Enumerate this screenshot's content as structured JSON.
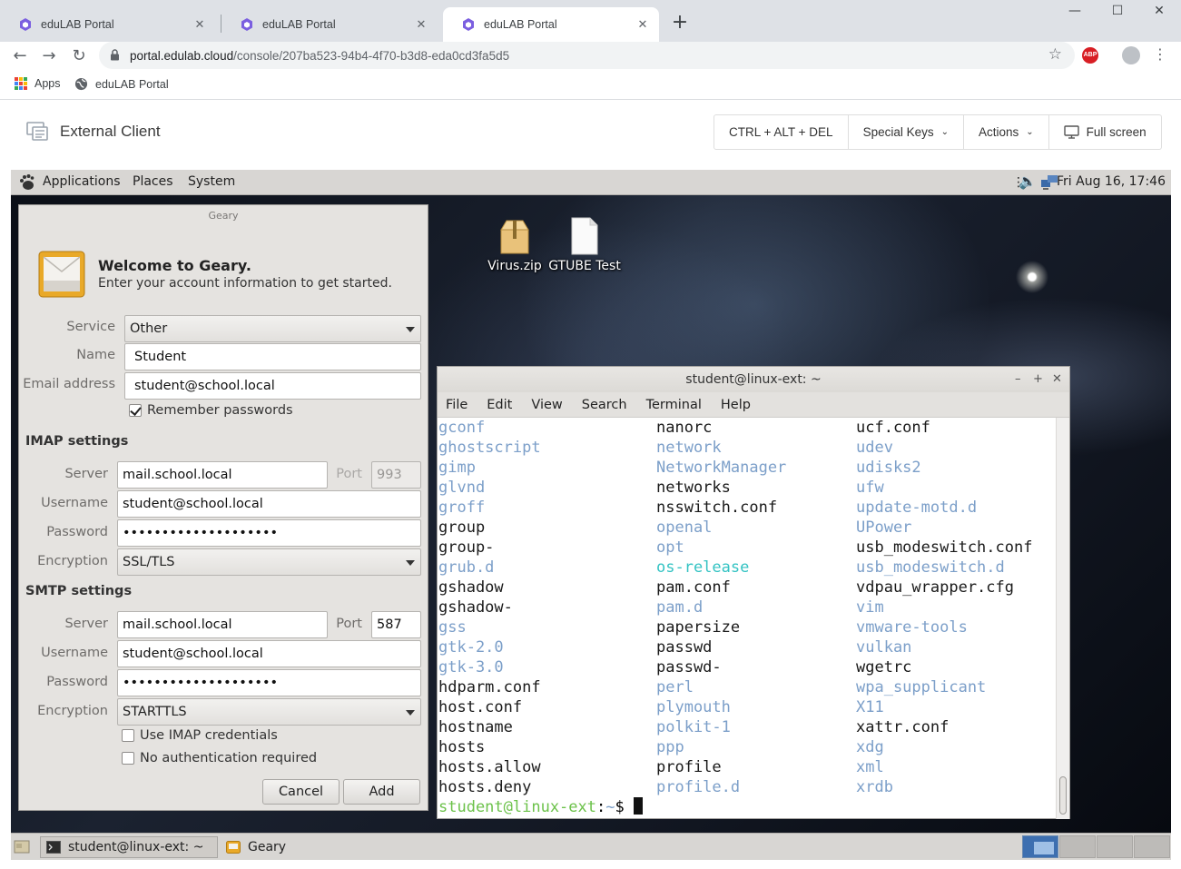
{
  "browser": {
    "tabs": [
      {
        "title": "eduLAB Portal",
        "active": false
      },
      {
        "title": "eduLAB Portal",
        "active": false
      },
      {
        "title": "eduLAB Portal",
        "active": true
      }
    ],
    "url_host": "portal.edulab.cloud",
    "url_path": "/console/207ba523-94b4-4f70-b3d8-eda0cd3fa5d5",
    "bookmarks": [
      {
        "label": "Apps",
        "icon": "apps-grid-icon"
      },
      {
        "label": "eduLAB Portal",
        "icon": "globe-icon"
      }
    ],
    "extension_badge": "ABP",
    "accent": "#7b5fe0"
  },
  "portal": {
    "title": "External Client",
    "buttons": {
      "ctrl_alt_del": "CTRL + ALT + DEL",
      "special_keys": "Special Keys",
      "actions": "Actions",
      "fullscreen": "Full screen"
    }
  },
  "remote": {
    "topbar": {
      "menus": [
        "Applications",
        "Places",
        "System"
      ],
      "clock": "Fri Aug 16, 17:46"
    },
    "desktop_icons": [
      {
        "label": "Virus.zip",
        "icon": "zip-archive-icon"
      },
      {
        "label": "GTUBE Test",
        "icon": "text-file-icon"
      }
    ],
    "taskbar": {
      "items": [
        {
          "label": "student@linux-ext: ~",
          "icon": "terminal-icon"
        },
        {
          "label": "Geary",
          "icon": "geary-mail-icon"
        }
      ]
    }
  },
  "geary": {
    "window_title": "Geary",
    "welcome": "Welcome to Geary.",
    "subtitle": "Enter your account information to get started.",
    "service_label": "Service",
    "service_value": "Other",
    "name_label": "Name",
    "name_value": "Student",
    "email_label": "Email address",
    "email_value": "student@school.local",
    "remember_label": "Remember passwords",
    "remember_checked": true,
    "imap": {
      "heading": "IMAP settings",
      "server_label": "Server",
      "server_value": "mail.school.local",
      "port_label": "Port",
      "port_value": "993",
      "username_label": "Username",
      "username_value": "student@school.local",
      "password_label": "Password",
      "password_value": "••••••••••••••••••••",
      "encryption_label": "Encryption",
      "encryption_value": "SSL/TLS"
    },
    "smtp": {
      "heading": "SMTP settings",
      "server_label": "Server",
      "server_value": "mail.school.local",
      "port_label": "Port",
      "port_value": "587",
      "username_label": "Username",
      "username_value": "student@school.local",
      "password_label": "Password",
      "password_value": "••••••••••••••••••••",
      "encryption_label": "Encryption",
      "encryption_value": "STARTTLS"
    },
    "use_imap_label": "Use IMAP credentials",
    "use_imap_checked": false,
    "no_auth_label": "No authentication required",
    "no_auth_checked": false,
    "cancel_label": "Cancel",
    "add_label": "Add"
  },
  "terminal": {
    "title": "student@linux-ext: ~",
    "menu": [
      "File",
      "Edit",
      "View",
      "Search",
      "Terminal",
      "Help"
    ],
    "columns": [
      [
        {
          "name": "gconf",
          "kind": "dir"
        },
        {
          "name": "ghostscript",
          "kind": "dir"
        },
        {
          "name": "gimp",
          "kind": "dir"
        },
        {
          "name": "glvnd",
          "kind": "dir"
        },
        {
          "name": "groff",
          "kind": "dir"
        },
        {
          "name": "group",
          "kind": "file"
        },
        {
          "name": "group-",
          "kind": "file"
        },
        {
          "name": "grub.d",
          "kind": "dir"
        },
        {
          "name": "gshadow",
          "kind": "file"
        },
        {
          "name": "gshadow-",
          "kind": "file"
        },
        {
          "name": "gss",
          "kind": "dir"
        },
        {
          "name": "gtk-2.0",
          "kind": "dir"
        },
        {
          "name": "gtk-3.0",
          "kind": "dir"
        },
        {
          "name": "hdparm.conf",
          "kind": "file"
        },
        {
          "name": "host.conf",
          "kind": "file"
        },
        {
          "name": "hostname",
          "kind": "file"
        },
        {
          "name": "hosts",
          "kind": "file"
        },
        {
          "name": "hosts.allow",
          "kind": "file"
        },
        {
          "name": "hosts.deny",
          "kind": "file"
        }
      ],
      [
        {
          "name": "nanorc",
          "kind": "file"
        },
        {
          "name": "network",
          "kind": "dir"
        },
        {
          "name": "NetworkManager",
          "kind": "dir"
        },
        {
          "name": "networks",
          "kind": "file"
        },
        {
          "name": "nsswitch.conf",
          "kind": "file"
        },
        {
          "name": "openal",
          "kind": "dir"
        },
        {
          "name": "opt",
          "kind": "dir"
        },
        {
          "name": "os-release",
          "kind": "link"
        },
        {
          "name": "pam.conf",
          "kind": "file"
        },
        {
          "name": "pam.d",
          "kind": "dir"
        },
        {
          "name": "papersize",
          "kind": "file"
        },
        {
          "name": "passwd",
          "kind": "file"
        },
        {
          "name": "passwd-",
          "kind": "file"
        },
        {
          "name": "perl",
          "kind": "dir"
        },
        {
          "name": "plymouth",
          "kind": "dir"
        },
        {
          "name": "polkit-1",
          "kind": "dir"
        },
        {
          "name": "ppp",
          "kind": "dir"
        },
        {
          "name": "profile",
          "kind": "file"
        },
        {
          "name": "profile.d",
          "kind": "dir"
        }
      ],
      [
        {
          "name": "ucf.conf",
          "kind": "file"
        },
        {
          "name": "udev",
          "kind": "dir"
        },
        {
          "name": "udisks2",
          "kind": "dir"
        },
        {
          "name": "ufw",
          "kind": "dir"
        },
        {
          "name": "update-motd.d",
          "kind": "dir"
        },
        {
          "name": "UPower",
          "kind": "dir"
        },
        {
          "name": "usb_modeswitch.conf",
          "kind": "file"
        },
        {
          "name": "usb_modeswitch.d",
          "kind": "dir"
        },
        {
          "name": "vdpau_wrapper.cfg",
          "kind": "file"
        },
        {
          "name": "vim",
          "kind": "dir"
        },
        {
          "name": "vmware-tools",
          "kind": "dir"
        },
        {
          "name": "vulkan",
          "kind": "dir"
        },
        {
          "name": "wgetrc",
          "kind": "file"
        },
        {
          "name": "wpa_supplicant",
          "kind": "dir"
        },
        {
          "name": "X11",
          "kind": "dir"
        },
        {
          "name": "xattr.conf",
          "kind": "file"
        },
        {
          "name": "xdg",
          "kind": "dir"
        },
        {
          "name": "xml",
          "kind": "dir"
        },
        {
          "name": "xrdb",
          "kind": "dir"
        }
      ]
    ],
    "prompt_user": "student@linux-ext",
    "prompt_sep": ":",
    "prompt_path": "~",
    "prompt_symbol": "$ ",
    "colors": {
      "dir": "#7c9fc9",
      "file": "#1a1a1a",
      "link": "#34c3c3",
      "prompt_user": "#6cc24a"
    }
  }
}
